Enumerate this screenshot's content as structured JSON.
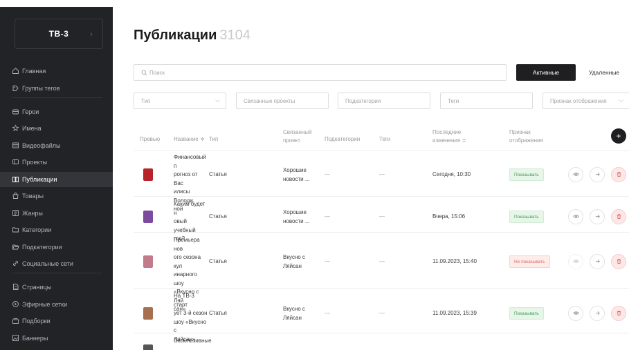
{
  "brand": {
    "name": "ТВ-3",
    "chevron": "›"
  },
  "sidebar": {
    "items": [
      {
        "label": "Главная",
        "icon": "home-icon"
      },
      {
        "label": "Группы тегов",
        "icon": "tag-group-icon"
      },
      {
        "label": "Герои",
        "icon": "heroes-icon"
      },
      {
        "label": "Имена",
        "icon": "star-icon"
      },
      {
        "label": "Видеофайлы",
        "icon": "video-icon"
      },
      {
        "label": "Проекты",
        "icon": "projects-icon"
      },
      {
        "label": "Публикации",
        "icon": "book-icon",
        "active": true
      },
      {
        "label": "Товары",
        "icon": "bag-icon"
      },
      {
        "label": "Жанры",
        "icon": "list-icon"
      },
      {
        "label": "Категории",
        "icon": "folder-icon"
      },
      {
        "label": "Подкатегории",
        "icon": "folder-open-icon"
      },
      {
        "label": "Социальные сети",
        "icon": "link-icon"
      },
      {
        "label": "Страницы",
        "icon": "page-icon"
      },
      {
        "label": "Эфирные сетки",
        "icon": "broadcast-icon"
      },
      {
        "label": "Подборки",
        "icon": "collection-icon"
      },
      {
        "label": "Баннеры",
        "icon": "banner-icon"
      }
    ]
  },
  "header": {
    "title": "Публикации",
    "count": "3104"
  },
  "search": {
    "placeholder": "Поиск"
  },
  "tabs": {
    "active_label": "Активные",
    "deleted_label": "Удаленные"
  },
  "filters": {
    "type": "Тип",
    "projects": "Связанные проекты",
    "subcategories": "Подкатегории",
    "tags": "Теги",
    "display": "Признак отображения"
  },
  "table": {
    "headers": {
      "preview": "Превью",
      "name": "Название ≑",
      "type": "Тип",
      "project_1": "Связанный",
      "project_2": "проект",
      "subcategories": "Подкатегории",
      "tags": "Теги",
      "changed_1": "Последние",
      "changed_2": "изменения ≑",
      "display_1": "Признак",
      "display_2": "отображения"
    },
    "add_label": "+",
    "rows": [
      {
        "name": [
          "Финансовый п",
          "рогноз от Вас",
          "илисы Володи",
          "ной"
        ],
        "type": "Статья",
        "project": [
          "Хорошие",
          "новости ..."
        ],
        "subcategories": "—",
        "tags": "—",
        "changed": "Сегодня, 10:30",
        "status": "Показывать",
        "status_kind": "show",
        "thumb_color": "#b8232b"
      },
      {
        "name": [
          "Каким будет н",
          "овый учебный",
          "год?"
        ],
        "type": "Статья",
        "project": [
          "Хорошие",
          "новости ..."
        ],
        "subcategories": "—",
        "tags": "—",
        "changed": "Вчера, 15:06",
        "status": "Показывать",
        "status_kind": "show",
        "thumb_color": "#7e4a9e"
      },
      {
        "name": [
          "Премьера нов",
          "ого сезона кул",
          "инарного шоу",
          "«Вкусно с Ляй",
          "сан»"
        ],
        "type": "Статья",
        "project": [
          "Вкусно с",
          "Ляйсан"
        ],
        "subcategories": "—",
        "tags": "—",
        "changed": "11.09.2023, 15:40",
        "status": "Не показывать",
        "status_kind": "hide",
        "thumb_color": "#c27b8a"
      },
      {
        "name": [
          "На ТВ-3 старт",
          "ует 3-й сезон",
          "шоу «Вкусно с",
          "Ляйсан»"
        ],
        "type": "Статья",
        "project": [
          "Вкусно с",
          "Ляйсан"
        ],
        "subcategories": "—",
        "tags": "—",
        "changed": "11.09.2023, 15:39",
        "status": "Показывать",
        "status_kind": "show",
        "thumb_color": "#a86f4f"
      },
      {
        "name": [
          "Эксклюзивные"
        ],
        "thumb_color": "#555555"
      }
    ]
  }
}
